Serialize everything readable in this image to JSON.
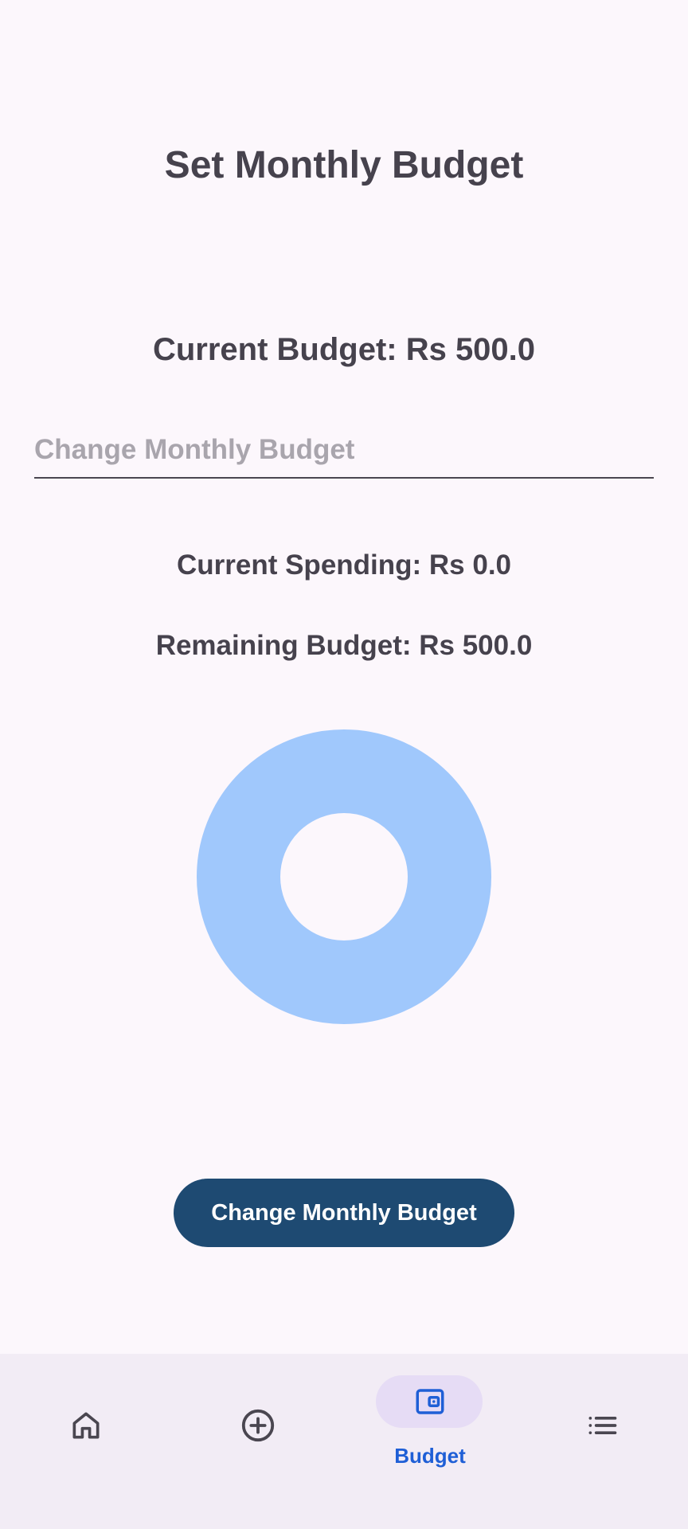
{
  "page": {
    "title": "Set Monthly Budget",
    "current_budget": "Current Budget: Rs 500.0",
    "input_placeholder": "Change Monthly Budget",
    "input_value": "",
    "current_spending": "Current Spending: Rs 0.0",
    "remaining_budget": "Remaining Budget: Rs 500.0",
    "button_label": "Change Monthly Budget"
  },
  "chart": {
    "type": "donut",
    "segments": [
      {
        "name": "Remaining",
        "value": 500.0,
        "color": "#a0c8fc"
      },
      {
        "name": "Spending",
        "value": 0.0,
        "color": "#1e4a72"
      }
    ]
  },
  "nav": {
    "items": [
      {
        "icon": "home-icon",
        "label": ""
      },
      {
        "icon": "add-circle-icon",
        "label": ""
      },
      {
        "icon": "wallet-icon",
        "label": "Budget",
        "selected": true
      },
      {
        "icon": "list-icon",
        "label": ""
      }
    ]
  },
  "colors": {
    "background": "#fcf7fc",
    "nav_background": "#f2ecf5",
    "button": "#1e4a72",
    "selected_pill": "#e6dcf5",
    "accent": "#1f5fd6",
    "chart_ring": "#a0c8fc"
  }
}
